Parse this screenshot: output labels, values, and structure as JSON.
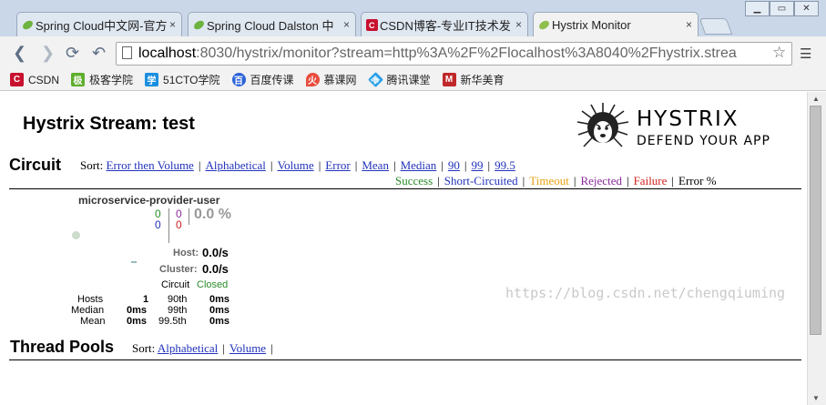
{
  "browser": {
    "tabs": [
      {
        "title": "Spring Cloud中文网-官方",
        "favicon_color": "#6db33f"
      },
      {
        "title": "Spring Cloud Dalston 中",
        "favicon_color": "#6db33f"
      },
      {
        "title": "CSDN博客-专业IT技术发",
        "favicon_color": "#c8102e"
      },
      {
        "title": "Hystrix Monitor",
        "favicon_color": "#8fbf4f"
      }
    ],
    "close_glyph": "×",
    "url_host": "localhost",
    "url_rest": ":8030/hystrix/monitor?stream=http%3A%2F%2Flocalhost%3A8040%2Fhystrix.strea",
    "bookmarks": [
      {
        "label": "CSDN",
        "icon": "C",
        "color": "#c8102e"
      },
      {
        "label": "极客学院",
        "icon": "极",
        "color": "#5fae2e"
      },
      {
        "label": "51CTO学院",
        "icon": "学",
        "color": "#1a8fe0"
      },
      {
        "label": "百度传课",
        "icon": "百",
        "color": "#2b63d8"
      },
      {
        "label": "慕课网",
        "icon": "火",
        "color": "#e84c3d"
      },
      {
        "label": "腾讯课堂",
        "icon": "腾",
        "color": "#2aa0e6"
      },
      {
        "label": "新华美育",
        "icon": "M",
        "color": "#c0282a"
      }
    ]
  },
  "header": {
    "title": "Hystrix Stream: test",
    "brand": "HYSTRIX",
    "tagline": "DEFEND YOUR APP"
  },
  "circuit": {
    "heading": "Circuit",
    "sort_label": "Sort:",
    "sort_options": [
      "Error then Volume",
      "Alphabetical",
      "Volume",
      "Error",
      "Mean",
      "Median",
      "90",
      "99",
      "99.5"
    ],
    "legend": [
      {
        "label": "Success",
        "color": "#2a8b2a"
      },
      {
        "label": "Short-Circuited",
        "color": "#2233bb"
      },
      {
        "label": "Timeout",
        "color": "#e8a013"
      },
      {
        "label": "Rejected",
        "color": "#8a2a9a"
      },
      {
        "label": "Failure",
        "color": "#d42020"
      },
      {
        "label": "Error %",
        "color": "#000000"
      }
    ],
    "card": {
      "name": "microservice-provider-user",
      "success": "0",
      "short_circuited": "0",
      "timeout": "0",
      "failure": "0",
      "rejected_color": "#8a2a9a",
      "error_pct": "0.0 %",
      "host_label": "Host:",
      "host_rate": "0.0/s",
      "cluster_label": "Cluster:",
      "cluster_rate": "0.0/s",
      "circuit_label": "Circuit",
      "circuit_status": "Closed",
      "stats": {
        "hosts_label": "Hosts",
        "hosts_value": "1",
        "median_label": "Median",
        "median_value": "0ms",
        "mean_label": "Mean",
        "mean_value": "0ms",
        "p90_label": "90th",
        "p90_value": "0ms",
        "p99_label": "99th",
        "p99_value": "0ms",
        "p995_label": "99.5th",
        "p995_value": "0ms"
      }
    }
  },
  "thread_pools": {
    "heading": "Thread Pools",
    "sort_label": "Sort:",
    "sort_options": [
      "Alphabetical",
      "Volume"
    ]
  },
  "watermark": "https://blog.csdn.net/chengqiuming"
}
